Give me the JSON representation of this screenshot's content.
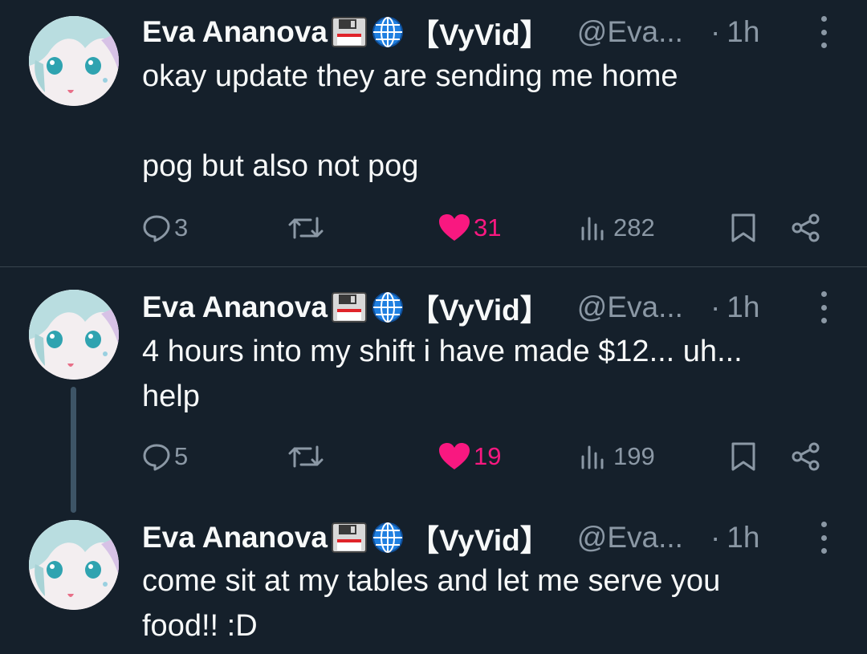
{
  "tweets": [
    {
      "name": "Eva Ananova",
      "tag": "【VyVid】",
      "handle": "@Eva...",
      "dot": "·",
      "time": "1h",
      "text": "okay update they are sending me home\n\npog but also not pog",
      "replies": "3",
      "likes": "31",
      "views": "282"
    },
    {
      "name": "Eva Ananova",
      "tag": "【VyVid】",
      "handle": "@Eva...",
      "dot": "·",
      "time": "1h",
      "text": "4 hours into my shift i have made $12... uh...\nhelp",
      "replies": "5",
      "likes": "19",
      "views": "199"
    },
    {
      "name": "Eva Ananova",
      "tag": "【VyVid】",
      "handle": "@Eva...",
      "dot": "·",
      "time": "1h",
      "text": "come sit at my tables and let me serve you\nfood!! :D"
    }
  ],
  "icons": {
    "floppy": "floppy-disk-icon",
    "globe": "globe-icon",
    "more": "more-icon",
    "reply": "reply-icon",
    "retweet": "retweet-icon",
    "like": "heart-icon",
    "views": "views-icon",
    "bookmark": "bookmark-icon",
    "share": "share-icon"
  },
  "colors": {
    "background": "#15202b",
    "text": "#f7f9f9",
    "secondary": "#8b98a5",
    "like": "#f91880",
    "divider": "#38444d",
    "thread_line": "#3d5466"
  }
}
